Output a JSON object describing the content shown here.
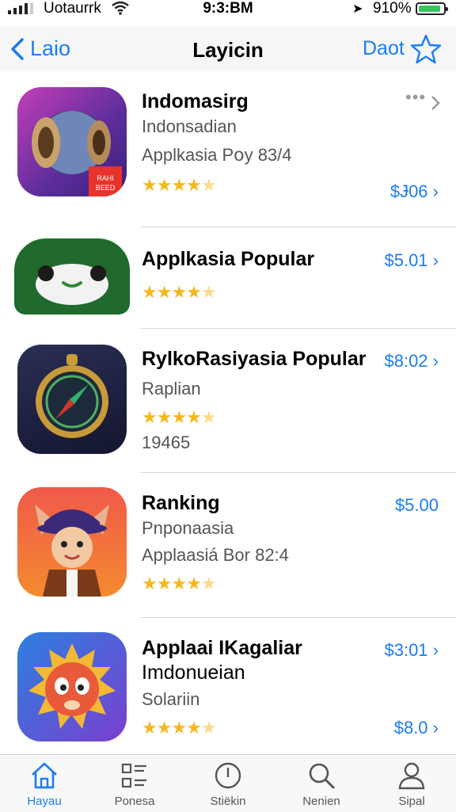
{
  "status": {
    "carrier": "Uotaurrk",
    "time": "9:3:BM",
    "battery": "910%",
    "battery_level": 0.9
  },
  "nav": {
    "back_label": "Laio",
    "title": "Layicin",
    "right_label": "Daot"
  },
  "apps": [
    {
      "name": "Indomasirg",
      "subtitle": "Indonsadian",
      "detail": "Applkasia Pօy 83/4",
      "rating": 4.5,
      "price": "$Ɉ06",
      "more": "•••"
    },
    {
      "name": "Applkasia Popular",
      "price": "$5.01",
      "rating": 4.5
    },
    {
      "name": "RylkoRasiyasia Popular",
      "subtitle": "Raplian",
      "detail": "19465",
      "rating": 4.5,
      "price": "$8:02"
    },
    {
      "name": "Ranking",
      "subtitle": "Pnponaasia",
      "detail": "Applaasiá Bor 82:4",
      "rating": 4.5,
      "price": "$5.00"
    },
    {
      "name": "Applaai IKagaliar",
      "subtitle": "Imdonueian",
      "detail": "Solariin",
      "rating": 4.5,
      "price_top": "$3:01",
      "price": "$8.0"
    }
  ],
  "tabs": [
    {
      "label": "Hayau",
      "icon": "home-icon",
      "active": true
    },
    {
      "label": "Ponesa",
      "icon": "list-icon",
      "active": false
    },
    {
      "label": "Stiëkin",
      "icon": "clock-icon",
      "active": false
    },
    {
      "label": "Nenien",
      "icon": "search-icon",
      "active": false
    },
    {
      "label": "Sipal",
      "icon": "person-icon",
      "active": false
    }
  ],
  "colors": {
    "accent": "#1b7cf2",
    "star": "#f5b81c",
    "active_tab": "#1b7cf2"
  }
}
